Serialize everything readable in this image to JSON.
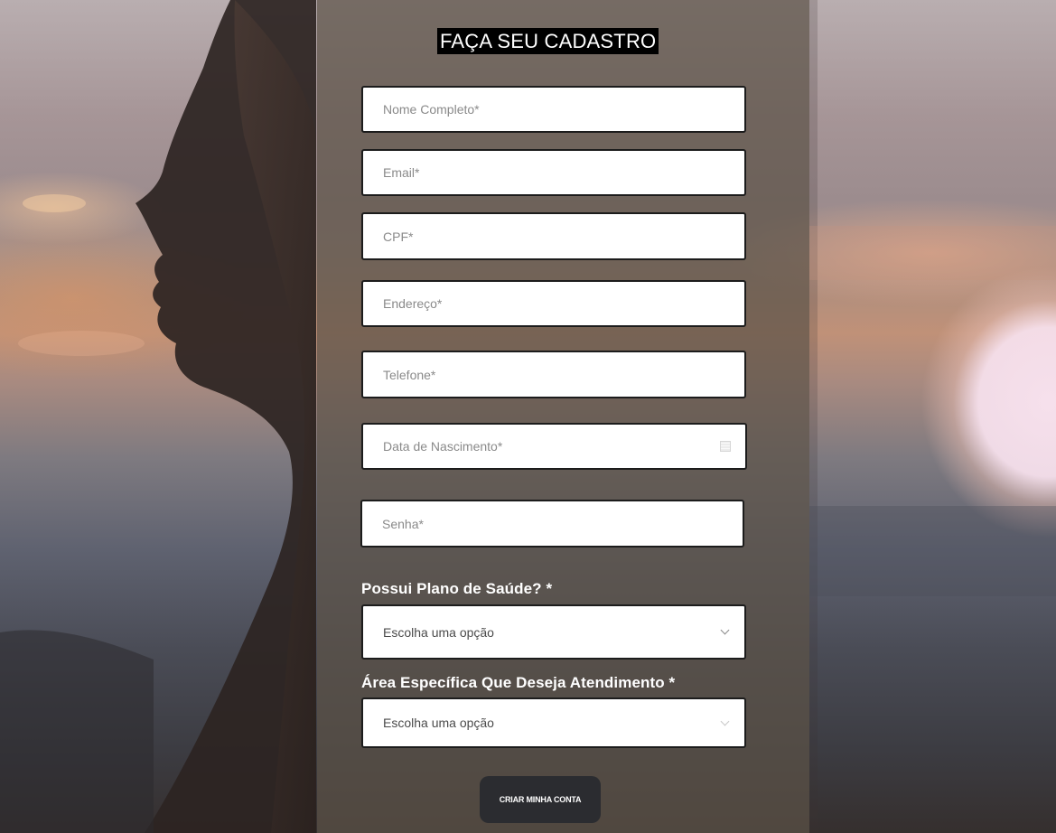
{
  "form": {
    "title": "FAÇA SEU CADASTRO",
    "fields": {
      "nome": "Nome Completo*",
      "email": "Email*",
      "cpf": "CPF*",
      "endereco": "Endereço*",
      "telefone": "Telefone*",
      "nascimento": "Data de Nascimento*",
      "senha": "Senha*"
    },
    "plano_saude": {
      "label": "Possui Plano de Saúde? *",
      "value": "Escolha uma opção"
    },
    "area": {
      "label": "Área Específica Que Deseja Atendimento *",
      "value": "Escolha uma opção"
    },
    "submit_label": "CRIAR MINHA CONTA"
  },
  "colors": {
    "panel_overlay": "#5c5246",
    "field_border": "#1c1c1c",
    "button_bg": "#2b2c30",
    "title_bg": "#000000"
  },
  "icons": {
    "date_field": "calendar-icon",
    "select": "chevron-down-icon"
  }
}
